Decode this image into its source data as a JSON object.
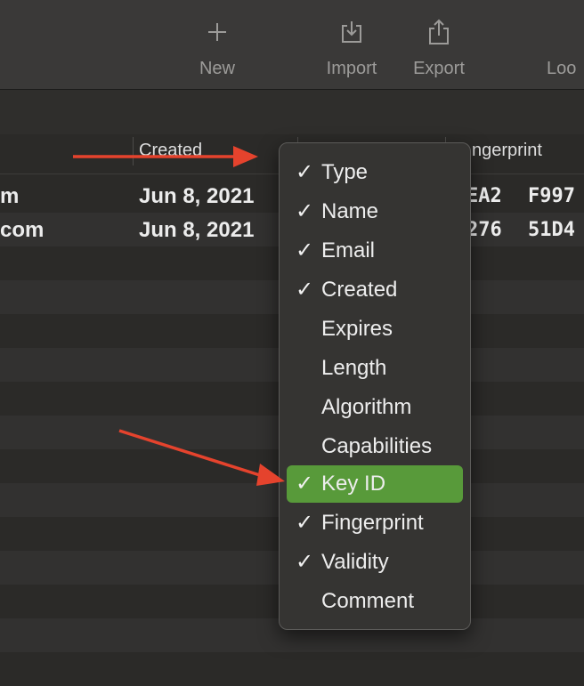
{
  "toolbar": {
    "new_label": "New",
    "import_label": "Import",
    "export_label": "Export",
    "lookup_label": "Loo"
  },
  "columns": {
    "created": "Created",
    "fingerprint": "ngerprint"
  },
  "rows": [
    {
      "name": "m",
      "created": "Jun 8, 2021",
      "fingerprint_a": "EA2",
      "fingerprint_b": "F997"
    },
    {
      "name": "com",
      "created": "Jun 8, 2021",
      "fingerprint_a": "276",
      "fingerprint_b": "51D4"
    }
  ],
  "menu": {
    "items": [
      {
        "label": "Type",
        "checked": "✓"
      },
      {
        "label": "Name",
        "checked": "✓"
      },
      {
        "label": "Email",
        "checked": "✓"
      },
      {
        "label": "Created",
        "checked": "✓"
      },
      {
        "label": "Expires",
        "checked": ""
      },
      {
        "label": "Length",
        "checked": ""
      },
      {
        "label": "Algorithm",
        "checked": ""
      },
      {
        "label": "Capabilities",
        "checked": ""
      },
      {
        "label": "Key ID",
        "checked": "✓"
      },
      {
        "label": "Fingerprint",
        "checked": "✓"
      },
      {
        "label": "Validity",
        "checked": "✓"
      },
      {
        "label": "Comment",
        "checked": ""
      }
    ],
    "selected": "Key ID"
  },
  "colors": {
    "highlight": "#589a3a",
    "annotation_arrow": "#e5432d"
  }
}
